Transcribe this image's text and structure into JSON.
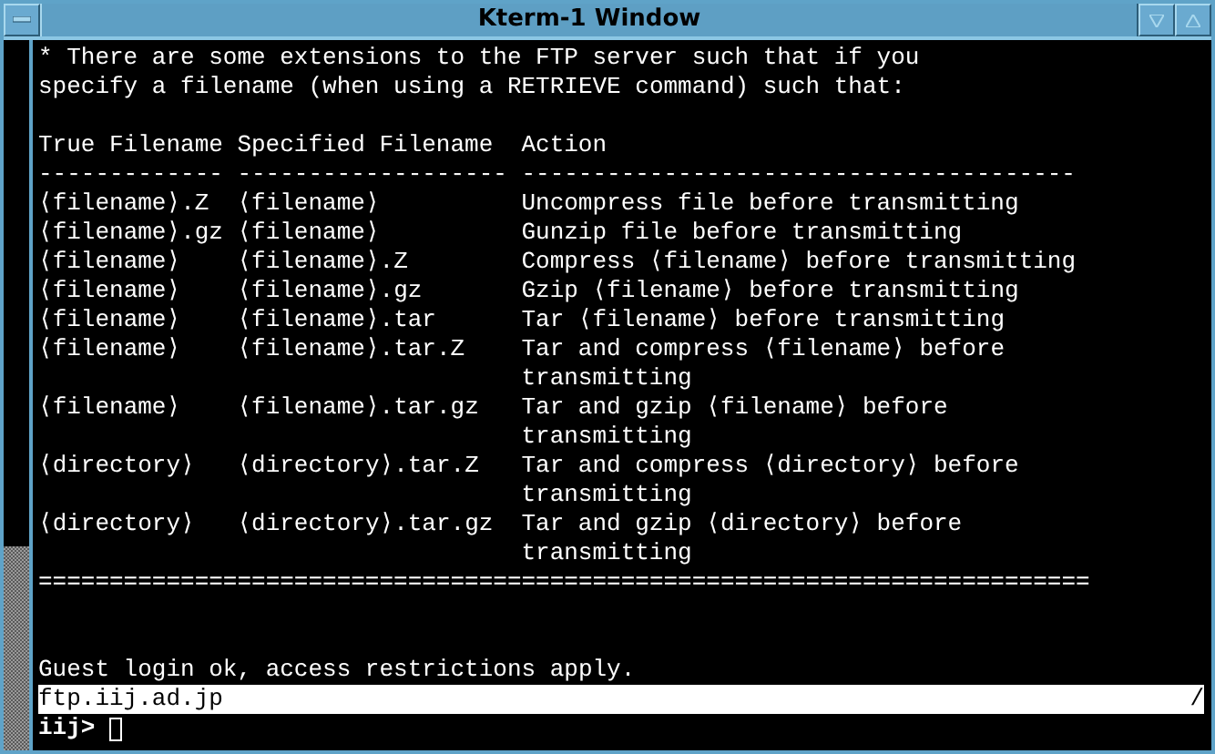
{
  "window": {
    "title": "Kterm-1 Window"
  },
  "terminal": {
    "intro": [
      "* There are some extensions to the FTP server such that if you",
      "specify a filename (when using a RETRIEVE command) such that:"
    ],
    "table": {
      "columns": [
        "True Filename",
        "Specified Filename",
        "Action"
      ],
      "rules": [
        "-------------",
        "-------------------",
        "---------------------------------------"
      ],
      "rows": [
        {
          "true_filename": "⟨filename⟩.Z",
          "specified_filename": "⟨filename⟩",
          "action": "Uncompress file before transmitting"
        },
        {
          "true_filename": "⟨filename⟩.gz",
          "specified_filename": "⟨filename⟩",
          "action": "Gunzip file before transmitting"
        },
        {
          "true_filename": "⟨filename⟩",
          "specified_filename": "⟨filename⟩.Z",
          "action": "Compress ⟨filename⟩ before transmitting"
        },
        {
          "true_filename": "⟨filename⟩",
          "specified_filename": "⟨filename⟩.gz",
          "action": "Gzip ⟨filename⟩ before transmitting"
        },
        {
          "true_filename": "⟨filename⟩",
          "specified_filename": "⟨filename⟩.tar",
          "action": "Tar ⟨filename⟩ before transmitting"
        },
        {
          "true_filename": "⟨filename⟩",
          "specified_filename": "⟨filename⟩.tar.Z",
          "action": "Tar and compress ⟨filename⟩ before transmitting"
        },
        {
          "true_filename": "⟨filename⟩",
          "specified_filename": "⟨filename⟩.tar.gz",
          "action": "Tar and gzip ⟨filename⟩ before transmitting"
        },
        {
          "true_filename": "⟨directory⟩",
          "specified_filename": "⟨directory⟩.tar.Z",
          "action": "Tar and compress ⟨directory⟩ before transmitting"
        },
        {
          "true_filename": "⟨directory⟩",
          "specified_filename": "⟨directory⟩.tar.gz",
          "action": "Tar and gzip ⟨directory⟩ before transmitting"
        }
      ]
    },
    "footer_rule": "==========================================================================",
    "message": "Guest login ok, access restrictions apply.",
    "status_line": {
      "host": "ftp.iij.ad.jp",
      "marker": "/"
    },
    "prompt": "iij>"
  }
}
